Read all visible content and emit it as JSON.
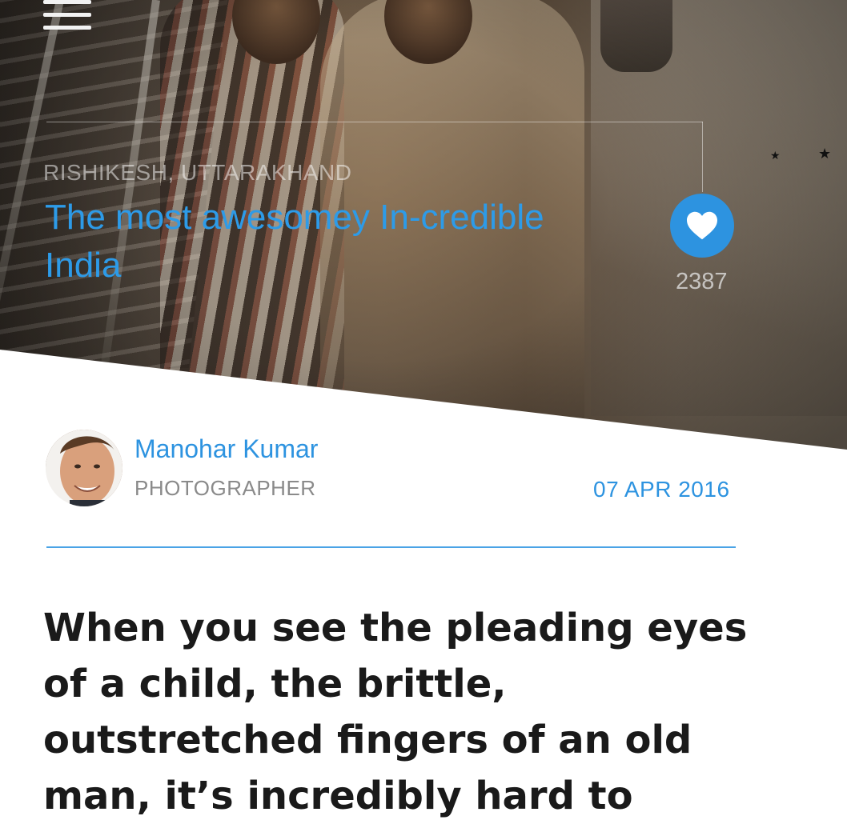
{
  "header": {
    "menu_icon": "hamburger-icon"
  },
  "hero": {
    "location": "RISHIKESH, UTTARAKHAND",
    "title": "The most awesomey In-credible\n India",
    "like_icon": "heart-icon",
    "like_count": "2387"
  },
  "author": {
    "name": "Manohar Kumar",
    "role": "PHOTOGRAPHER",
    "date": "07 APR 2016"
  },
  "article": {
    "body": "When you see the pleading eyes of a child, the brittle, outstretched fingers of an old man, it’s incredibly hard to"
  },
  "colors": {
    "accent": "#2d93e0",
    "title_blue": "#2d9be8",
    "text_dark": "#1a1a1a",
    "muted": "#8a8a8a"
  }
}
